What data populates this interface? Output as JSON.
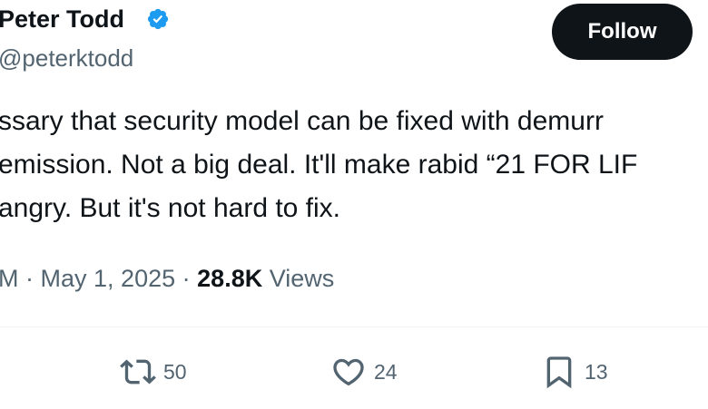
{
  "author": {
    "display_name": "Peter Todd",
    "handle": "@peterktodd",
    "verified_icon": "verified-badge-icon",
    "badge_color": "#1d9bf0"
  },
  "follow_button": {
    "label": "Follow"
  },
  "tweet": {
    "lines": [
      "ssary that security model can be fixed with demurr",
      "emission. Not a big deal. It'll make rabid “21 FOR LIF",
      "angry. But it's not hard to fix."
    ]
  },
  "meta": {
    "time_fragment": "M",
    "separator": "·",
    "date": "May 1, 2025",
    "views_count": "28.8K",
    "views_label": "Views"
  },
  "actions": {
    "retweet": {
      "icon": "retweet-icon",
      "count": "50"
    },
    "like": {
      "icon": "heart-icon",
      "count": "24"
    },
    "bookmark": {
      "icon": "bookmark-icon",
      "count": "13"
    }
  },
  "colors": {
    "text_primary": "#0f1419",
    "text_secondary": "#536471",
    "button_bg": "#0f1419",
    "divider": "#eff3f4"
  }
}
